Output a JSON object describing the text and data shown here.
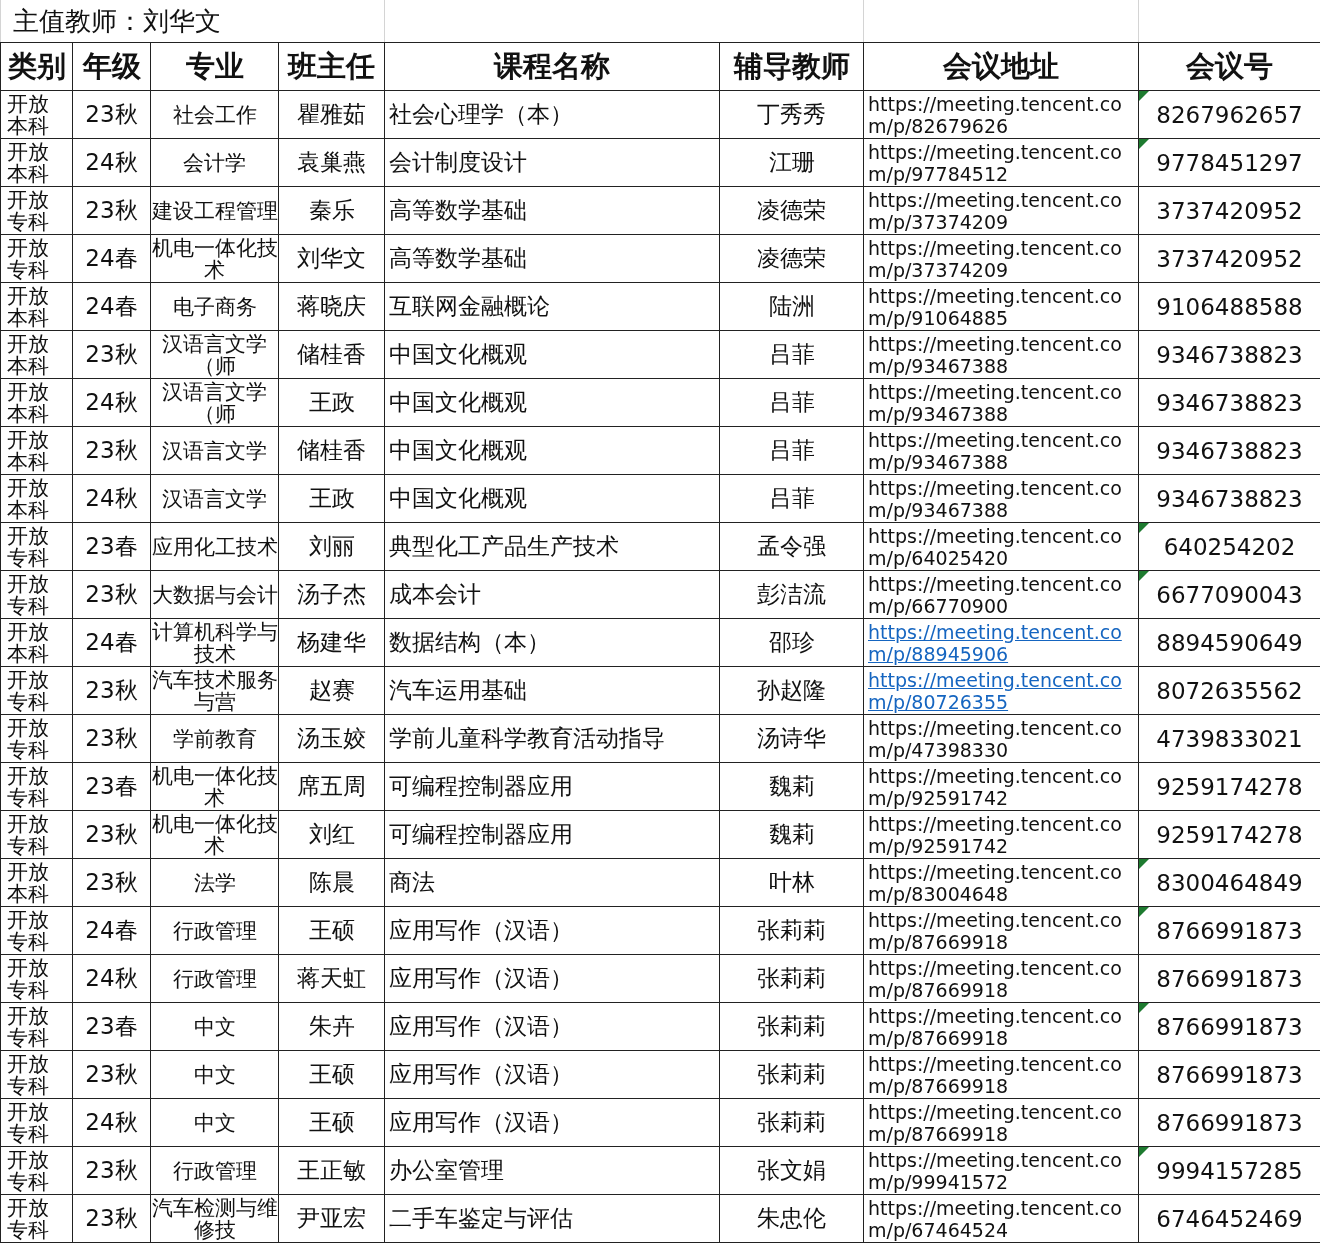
{
  "title": "主值教师：刘华文",
  "columns": [
    "类别",
    "年级",
    "专业",
    "班主任",
    "课程名称",
    "辅导教师",
    "会议地址",
    "会议号"
  ],
  "rows": [
    {
      "category": "开放本科",
      "grade": "23秋",
      "major": "社会工作",
      "head_teacher": "瞿雅茹",
      "course": "社会心理学（本）",
      "tutor": "丁秀秀",
      "url": "https://meeting.tencent.com/p/82679626",
      "url_is_link": false,
      "meeting_id": "8267962657",
      "text_number_flag": true
    },
    {
      "category": "开放本科",
      "grade": "24秋",
      "major": "会计学",
      "head_teacher": "袁巢燕",
      "course": "会计制度设计",
      "tutor": "江珊",
      "url": "https://meeting.tencent.com/p/97784512",
      "url_is_link": false,
      "meeting_id": "9778451297",
      "text_number_flag": true
    },
    {
      "category": "开放专科",
      "grade": "23秋",
      "major": "建设工程管理",
      "head_teacher": "秦乐",
      "course": "高等数学基础",
      "tutor": "凌德荣",
      "url": "https://meeting.tencent.com/p/37374209",
      "url_is_link": false,
      "meeting_id": "3737420952",
      "text_number_flag": false
    },
    {
      "category": "开放专科",
      "grade": "24春",
      "major": "机电一体化技术",
      "head_teacher": "刘华文",
      "course": "高等数学基础",
      "tutor": "凌德荣",
      "url": "https://meeting.tencent.com/p/37374209",
      "url_is_link": false,
      "meeting_id": "3737420952",
      "text_number_flag": false
    },
    {
      "category": "开放本科",
      "grade": "24春",
      "major": "电子商务",
      "head_teacher": "蒋晓庆",
      "course": "互联网金融概论",
      "tutor": "陆洲",
      "url": "https://meeting.tencent.com/p/91064885",
      "url_is_link": false,
      "meeting_id": "9106488588",
      "text_number_flag": false
    },
    {
      "category": "开放本科",
      "grade": "23秋",
      "major": "汉语言文学（师",
      "head_teacher": "储桂香",
      "course": "中国文化概观",
      "tutor": "吕菲",
      "url": "https://meeting.tencent.com/p/93467388",
      "url_is_link": false,
      "meeting_id": "9346738823",
      "text_number_flag": false
    },
    {
      "category": "开放本科",
      "grade": "24秋",
      "major": "汉语言文学（师",
      "head_teacher": "王政",
      "course": "中国文化概观",
      "tutor": "吕菲",
      "url": "https://meeting.tencent.com/p/93467388",
      "url_is_link": false,
      "meeting_id": "9346738823",
      "text_number_flag": false
    },
    {
      "category": "开放本科",
      "grade": "23秋",
      "major": "汉语言文学",
      "head_teacher": "储桂香",
      "course": "中国文化概观",
      "tutor": "吕菲",
      "url": "https://meeting.tencent.com/p/93467388",
      "url_is_link": false,
      "meeting_id": "9346738823",
      "text_number_flag": false
    },
    {
      "category": "开放本科",
      "grade": "24秋",
      "major": "汉语言文学",
      "head_teacher": "王政",
      "course": "中国文化概观",
      "tutor": "吕菲",
      "url": "https://meeting.tencent.com/p/93467388",
      "url_is_link": false,
      "meeting_id": "9346738823",
      "text_number_flag": false
    },
    {
      "category": "开放专科",
      "grade": "23春",
      "major": "应用化工技术",
      "head_teacher": "刘丽",
      "course": "典型化工产品生产技术",
      "tutor": "孟令强",
      "url": "https://meeting.tencent.com/p/64025420",
      "url_is_link": false,
      "meeting_id": "640254202",
      "text_number_flag": true
    },
    {
      "category": "开放专科",
      "grade": "23秋",
      "major": "大数据与会计",
      "head_teacher": "汤子杰",
      "course": "成本会计",
      "tutor": "彭洁流",
      "url": "https://meeting.tencent.com/p/66770900",
      "url_is_link": false,
      "meeting_id": "6677090043",
      "text_number_flag": true
    },
    {
      "category": "开放本科",
      "grade": "24春",
      "major": "计算机科学与技术",
      "head_teacher": "杨建华",
      "course": "数据结构（本）",
      "tutor": "邵珍",
      "url": "https://meeting.tencent.com/p/88945906",
      "url_is_link": true,
      "meeting_id": "8894590649",
      "text_number_flag": false
    },
    {
      "category": "开放专科",
      "grade": "23秋",
      "major": "汽车技术服务与营",
      "head_teacher": "赵赛",
      "course": "汽车运用基础",
      "tutor": "孙赵隆",
      "url": "https://meeting.tencent.com/p/80726355",
      "url_is_link": true,
      "meeting_id": "8072635562",
      "text_number_flag": false
    },
    {
      "category": "开放专科",
      "grade": "23秋",
      "major": "学前教育",
      "head_teacher": "汤玉姣",
      "course": "学前儿童科学教育活动指导",
      "tutor": "汤诗华",
      "url": "https://meeting.tencent.com/p/47398330",
      "url_is_link": false,
      "meeting_id": "4739833021",
      "text_number_flag": false
    },
    {
      "category": "开放专科",
      "grade": "23春",
      "major": "机电一体化技术",
      "head_teacher": "席五周",
      "course": "可编程控制器应用",
      "tutor": "魏莉",
      "url": "https://meeting.tencent.com/p/92591742",
      "url_is_link": false,
      "meeting_id": "9259174278",
      "text_number_flag": false
    },
    {
      "category": "开放专科",
      "grade": "23秋",
      "major": "机电一体化技术",
      "head_teacher": "刘红",
      "course": "可编程控制器应用",
      "tutor": "魏莉",
      "url": "https://meeting.tencent.com/p/92591742",
      "url_is_link": false,
      "meeting_id": "9259174278",
      "text_number_flag": false
    },
    {
      "category": "开放本科",
      "grade": "23秋",
      "major": "法学",
      "head_teacher": "陈晨",
      "course": "商法",
      "tutor": "叶林",
      "url": "https://meeting.tencent.com/p/83004648",
      "url_is_link": false,
      "meeting_id": "8300464849",
      "text_number_flag": true
    },
    {
      "category": "开放专科",
      "grade": "24春",
      "major": "行政管理",
      "head_teacher": "王硕",
      "course": "应用写作（汉语）",
      "tutor": "张莉莉",
      "url": "https://meeting.tencent.com/p/87669918",
      "url_is_link": false,
      "meeting_id": "8766991873",
      "text_number_flag": true
    },
    {
      "category": "开放专科",
      "grade": "24秋",
      "major": "行政管理",
      "head_teacher": "蒋天虹",
      "course": "应用写作（汉语）",
      "tutor": "张莉莉",
      "url": "https://meeting.tencent.com/p/87669918",
      "url_is_link": false,
      "meeting_id": "8766991873",
      "text_number_flag": false
    },
    {
      "category": "开放专科",
      "grade": "23春",
      "major": "中文",
      "head_teacher": "朱卉",
      "course": "应用写作（汉语）",
      "tutor": "张莉莉",
      "url": "https://meeting.tencent.com/p/87669918",
      "url_is_link": false,
      "meeting_id": "8766991873",
      "text_number_flag": true
    },
    {
      "category": "开放专科",
      "grade": "23秋",
      "major": "中文",
      "head_teacher": "王硕",
      "course": "应用写作（汉语）",
      "tutor": "张莉莉",
      "url": "https://meeting.tencent.com/p/87669918",
      "url_is_link": false,
      "meeting_id": "8766991873",
      "text_number_flag": false
    },
    {
      "category": "开放专科",
      "grade": "24秋",
      "major": "中文",
      "head_teacher": "王硕",
      "course": "应用写作（汉语）",
      "tutor": "张莉莉",
      "url": "https://meeting.tencent.com/p/87669918",
      "url_is_link": false,
      "meeting_id": "8766991873",
      "text_number_flag": false
    },
    {
      "category": "开放专科",
      "grade": "23秋",
      "major": "行政管理",
      "head_teacher": "王正敏",
      "course": "办公室管理",
      "tutor": "张文娟",
      "url": "https://meeting.tencent.com/p/99941572",
      "url_is_link": false,
      "meeting_id": "9994157285",
      "text_number_flag": true
    },
    {
      "category": "开放专科",
      "grade": "23秋",
      "major": "汽车检测与维修技",
      "head_teacher": "尹亚宏",
      "course": "二手车鉴定与评估",
      "tutor": "朱忠伦",
      "url": "https://meeting.tencent.com/p/67464524",
      "url_is_link": false,
      "meeting_id": "6746452469",
      "text_number_flag": false
    }
  ]
}
